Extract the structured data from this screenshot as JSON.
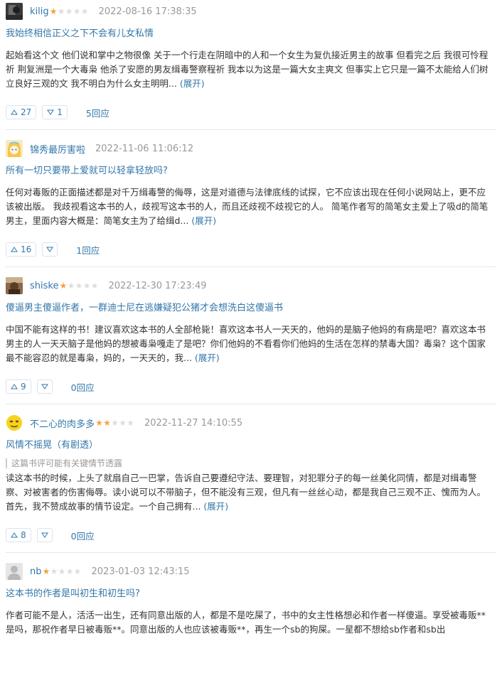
{
  "reviews": [
    {
      "username": "kilig",
      "rating": 1,
      "date": "2022-08-16 17:38:35",
      "title": "我始终相信正义之下不会有儿女私情",
      "spoiler": "",
      "body": "起始看这个文 他们说和掌中之物很像 关于一个行走在阴暗中的人和一个女生为复仇接近男主的故事 但看完之后 我很可怜程祈 荆复洲是一个大毒枭 他杀了安愿的男友缉毒警察程祈 我本以为这是一篇大女主爽文 但事实上它只是一篇不太能给人们树立良好三观的文 我不明白为什么女主明明...",
      "expand": "(展开)",
      "up": "27",
      "down": "1",
      "replies": "5回应",
      "avatar": "dark-photo"
    },
    {
      "username": "锦秀最厉害啦",
      "rating": 0,
      "date": "2022-11-06 11:06:12",
      "title": "所有一切只要带上爱就可以轻拿轻放吗?",
      "spoiler": "",
      "body": "任何对毒贩的正面描述都是对千万缉毒警的侮辱，这是对道德与法律底线的试探，它不应该出现在任何小说网站上，更不应该被出版。 我歧视看这本书的人，歧视写这本书的人，而且还歧视不歧视它的人。 简笔作者写的简笔女主爱上了吸d的简笔男主，里面内容大概是：简笔女主为了给缉d...",
      "expand": "(展开)",
      "up": "16",
      "down": "",
      "replies": "1回应",
      "avatar": "anime-girl"
    },
    {
      "username": "shiske",
      "rating": 1,
      "date": "2022-12-30 17:23:49",
      "title": "傻逼男主傻逼作者，一群迪士尼在逃嫌疑犯公猪才会想洗白这傻逼书",
      "spoiler": "",
      "body": "中国不能有这样的书！建议喜欢这本书的人全部枪毙！喜欢这本书人一天天的，他妈的是脑子他妈的有病是吧？喜欢这本书男主的人一天天脑子是他妈的想被毒枭嘎走了是吧？你们他妈的不看看你们他妈的生活在怎样的禁毒大国？毒枭？这个国家最不能容忍的就是毒枭，妈的，一天天的，我...",
      "expand": "(展开)",
      "up": "9",
      "down": "",
      "replies": "0回应",
      "avatar": "brown-photo"
    },
    {
      "username": "不二心的肉多多",
      "rating": 2,
      "date": "2022-11-27 14:10:55",
      "title": "风情不摇晃（有剧透）",
      "spoiler": "这篇书评可能有关键情节透露",
      "body": "读这本书的时候，上头了就扇自己一巴掌，告诉自己要遵纪守法、要理智，对犯罪分子的每一丝美化同情，都是对缉毒警察、对被害者的伤害侮辱。读小说可以不带脑子，但不能没有三观，但凡有一丝丝心动，都是我自己三观不正、愧而为人。 首先，我不赞成故事的情节设定。一个自己拥有...",
      "expand": "(展开)",
      "up": "8",
      "down": "",
      "replies": "0回应",
      "avatar": "yellow-face"
    },
    {
      "username": "nb",
      "rating": 1,
      "date": "2023-01-03 12:43:15",
      "title": "这本书的作者是叫初生和初生吗?",
      "spoiler": "",
      "body": "作者可能不是人，活活一出生，还有同意出版的人，都是不是吃屎了，书中的女主性格想必和作者一样傻逼。享受被毒贩**是吗，那祝作者早日被毒贩**。同意出版的人也应该被毒贩**，再生一个sb的狗屎。一星都不想给sb作者和sb出",
      "expand": "",
      "up": "",
      "down": "",
      "replies": "",
      "avatar": "default-gray"
    }
  ]
}
